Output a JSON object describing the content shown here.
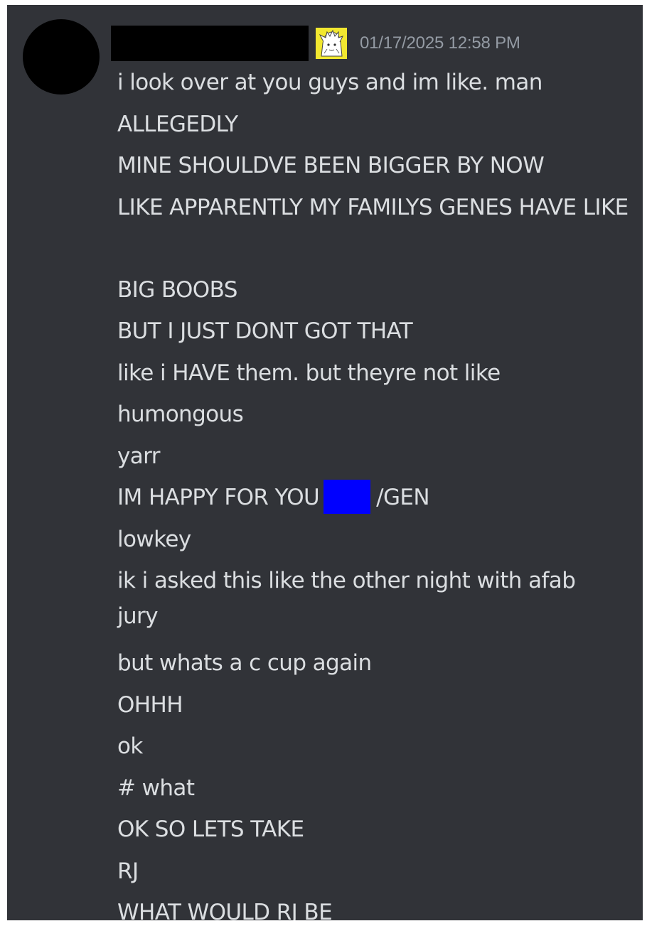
{
  "message": {
    "timestamp": "01/17/2025 12:58 PM",
    "lines": [
      "i look over at you guys and im like. man",
      "ALLEGEDLY",
      "MINE SHOULDVE BEEN BIGGER BY NOW",
      "LIKE APPARENTLY MY FAMILYS GENES HAVE LIKE",
      "BIG BOOBS",
      "BUT I JUST DONT GOT THAT",
      "like i HAVE them. but theyre not like",
      "humongous",
      "yarr",
      "IM HAPPY FOR YOU",
      "/GEN",
      "lowkey",
      "ik i asked this like the other night with afab jury",
      "but whats a c cup again",
      "OHHH",
      "ok",
      "# what",
      "OK SO LETS TAKE",
      "RJ",
      "WHAT WOULD RJ BE"
    ]
  },
  "colors": {
    "background": "#313338",
    "text": "#dbdee1",
    "timestamp": "#949ba4",
    "redaction_username": "#000000",
    "redaction_mention": "#0000ff",
    "badge": "#f2e830"
  },
  "icons": {
    "avatar": "avatar-redacted",
    "badge": "anime-character-badge-icon"
  }
}
